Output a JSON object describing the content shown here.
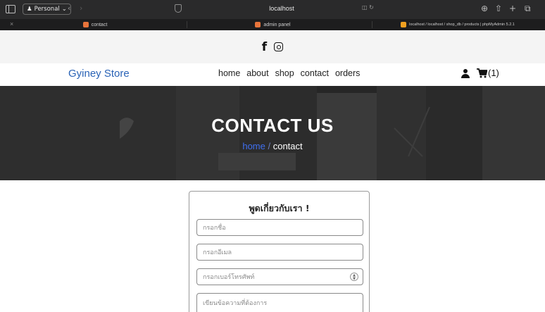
{
  "browser": {
    "profile_label": "Personal",
    "url": "localhost",
    "tabs": [
      {
        "label": "contact",
        "favicon_color": "#e8743b"
      },
      {
        "label": "admin panel",
        "favicon_color": "#e8743b"
      },
      {
        "label": "localhost / localhost / shop_db / products | phpMyAdmin 5.2.1",
        "favicon_color": "#f0a020"
      }
    ]
  },
  "social": {
    "icons": [
      "facebook-icon",
      "instagram-icon"
    ]
  },
  "navbar": {
    "brand": "Gyiney Store",
    "menu": [
      "home",
      "about",
      "shop",
      "contact",
      "orders"
    ],
    "cart_count": "(1)"
  },
  "hero": {
    "title": "CONTACT US",
    "breadcrumb_home": "home",
    "breadcrumb_sep": " / ",
    "breadcrumb_current": "contact"
  },
  "form": {
    "title": "พูดเกี่ยวกับเรา !",
    "name_placeholder": "กรอกชื่อ",
    "email_placeholder": "กรอกอีเมล",
    "phone_placeholder": "กรอกเบอร์โทรศัพท์",
    "message_placeholder": "เขียนข้อความที่ต้องการ"
  },
  "colors": {
    "brand": "#2a63b6",
    "breadcrumb_link": "#3f6ff0",
    "hero_bg": "#2b2b2b"
  }
}
